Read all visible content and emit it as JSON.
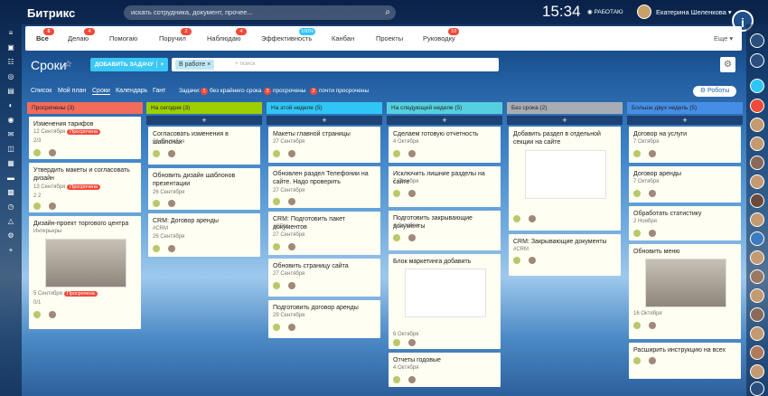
{
  "header": {
    "logo": "Битрикс",
    "search_placeholder": "искать сотрудника, документ, прочее...",
    "time": "15:34",
    "work_status": "РАБОТАЮ",
    "user": "Екатерина Шеленкова"
  },
  "menu": [
    {
      "label": "Все",
      "badge": "6"
    },
    {
      "label": "Делаю",
      "badge": "4"
    },
    {
      "label": "Помогаю",
      "badge": ""
    },
    {
      "label": "Поручил",
      "badge": "2"
    },
    {
      "label": "Наблюдаю",
      "badge": "4"
    },
    {
      "label": "Эффективность",
      "badge": "100%"
    },
    {
      "label": "Канбан",
      "badge": ""
    },
    {
      "label": "Проекты",
      "badge": ""
    },
    {
      "label": "Руководку",
      "badge": "10"
    }
  ],
  "menu_more": "Еще",
  "page": {
    "title": "Сроки",
    "add_task": "ДОБАВИТЬ ЗАДАЧУ",
    "filter_chip": "В работе",
    "filter_placeholder": "+ поиск"
  },
  "views": [
    "Список",
    "Мой план",
    "Сроки",
    "Календарь",
    "Гант"
  ],
  "deadlines": {
    "label": "Задачи:",
    "items": [
      {
        "n": "1",
        "t": "без крайнего срока"
      },
      {
        "n": "3",
        "t": "просрочены"
      },
      {
        "n": "2",
        "t": "почти просрочены"
      }
    ]
  },
  "robots": "Роботы",
  "columns": [
    {
      "title": "Просрочены",
      "color": "#f26b5b",
      "cards": [
        {
          "title": "Изменения тарифов",
          "date": "12 Сентября",
          "tag": "Просрочена",
          "meta": "2/3",
          "h": 47
        },
        {
          "title": "Утвердить макеты и согласовать дизайн",
          "date": "13 Сентября",
          "tag": "Просрочена",
          "meta": "2  2",
          "h": 55
        },
        {
          "title": "Дизайн-проект торгового центра",
          "sub": "Интерьеры",
          "date": "5 Сентября",
          "tag": "Просрочена",
          "meta": "0/1",
          "img": true,
          "h": 125
        }
      ]
    },
    {
      "title": "На сегодня",
      "color": "#9dcf00",
      "cards": [
        {
          "title": "Согласовать изменения в шаблонах",
          "date": "26 Сентября",
          "h": 42
        },
        {
          "title": "Обновить дизайн шаблонов презентации",
          "date": "26 Сентября",
          "h": 46
        },
        {
          "title": "CRM: Договор аренды",
          "sub": "#CRM",
          "date": "26 Сентября",
          "h": 48
        }
      ]
    },
    {
      "title": "На этой неделе",
      "color": "#2fc6f6",
      "cards": [
        {
          "title": "Макеты главной страницы",
          "date": "27 Сентября",
          "h": 40
        },
        {
          "title": "Обновлен раздел Телефонии на сайте. Надо проверить",
          "date": "27 Сентября",
          "h": 46
        },
        {
          "title": "CRM: Подготовить пакет документов",
          "sub": "#CRM",
          "date": "27 Сентября",
          "h": 48
        },
        {
          "title": "Обновить страницу сайта",
          "date": "27 Сентября",
          "h": 42
        },
        {
          "title": "Подготовить договор аренды",
          "date": "29 Сентября",
          "h": 42
        }
      ]
    },
    {
      "title": "На следующей неделе",
      "color": "#55d0e0",
      "cards": [
        {
          "title": "Сделаем готовую отчетность",
          "date": "4 Октября",
          "h": 40
        },
        {
          "title": "Исключить лишние разделы на сайте",
          "date": "7 Октября",
          "h": 45
        },
        {
          "title": "Подготовить закрывающие документы",
          "date": "4 Октября",
          "h": 44
        },
        {
          "title": "Блок маркетинга добавить",
          "date": "6 Октября",
          "doc": true,
          "h": 105
        },
        {
          "title": "Отчеты годовые",
          "date": "4 Октября",
          "h": 38
        }
      ]
    },
    {
      "title": "Без срока",
      "color": "#a8adb4",
      "cards": [
        {
          "title": "Добавить раздел в отдельной секции на сайте",
          "doc2": true,
          "h": 115
        },
        {
          "title": "CRM: Закрывающие документы",
          "sub": "#CRM",
          "h": 46
        }
      ]
    },
    {
      "title": "Больше двух недель",
      "color": "#468ee5",
      "cards": [
        {
          "title": "Договор на услуги",
          "date": "7 Октября",
          "h": 40
        },
        {
          "title": "Договор аренды",
          "date": "7 Октября",
          "h": 40
        },
        {
          "title": "Обработать статистику",
          "date": "2 Ноября",
          "h": 38
        },
        {
          "title": "Обновить меню",
          "date": "16 Октября",
          "img": true,
          "h": 105
        },
        {
          "title": "Расширить инструкцию на всех",
          "h": 40
        }
      ]
    }
  ]
}
